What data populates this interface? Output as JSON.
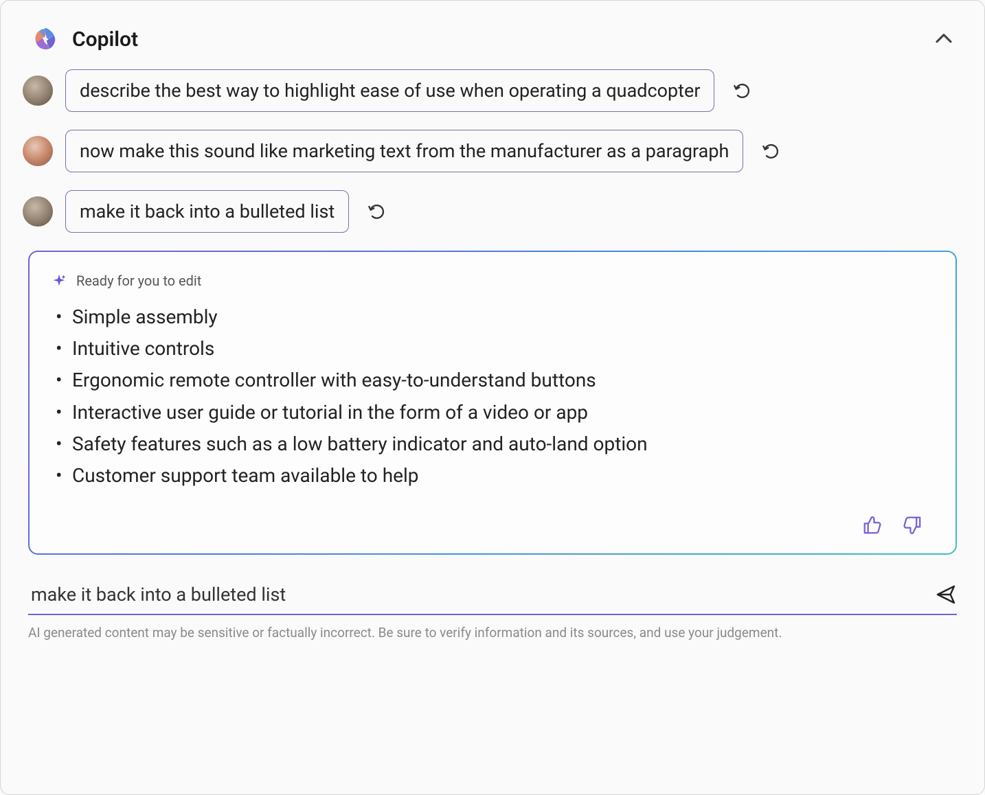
{
  "header": {
    "title": "Copilot"
  },
  "messages": [
    {
      "text": "describe the best way to highlight ease of use when operating a quadcopter",
      "avatarVariant": 1
    },
    {
      "text": "now make this sound like marketing text from the manufacturer as a paragraph",
      "avatarVariant": 2
    },
    {
      "text": "make it back into a bulleted list",
      "avatarVariant": 1
    }
  ],
  "response": {
    "readyText": "Ready for you to edit",
    "bullets": [
      "Simple assembly",
      "Intuitive controls",
      "Ergonomic remote controller with easy-to-understand buttons",
      "Interactive user guide or tutorial in the form of a video or app",
      "Safety features such as a low battery indicator and auto-land option",
      "Customer support team available to help"
    ]
  },
  "input": {
    "value": "make it back into a bulleted list"
  },
  "disclaimer": "AI generated content may be sensitive or factually incorrect. Be sure to verify information and its sources, and use your judgement."
}
